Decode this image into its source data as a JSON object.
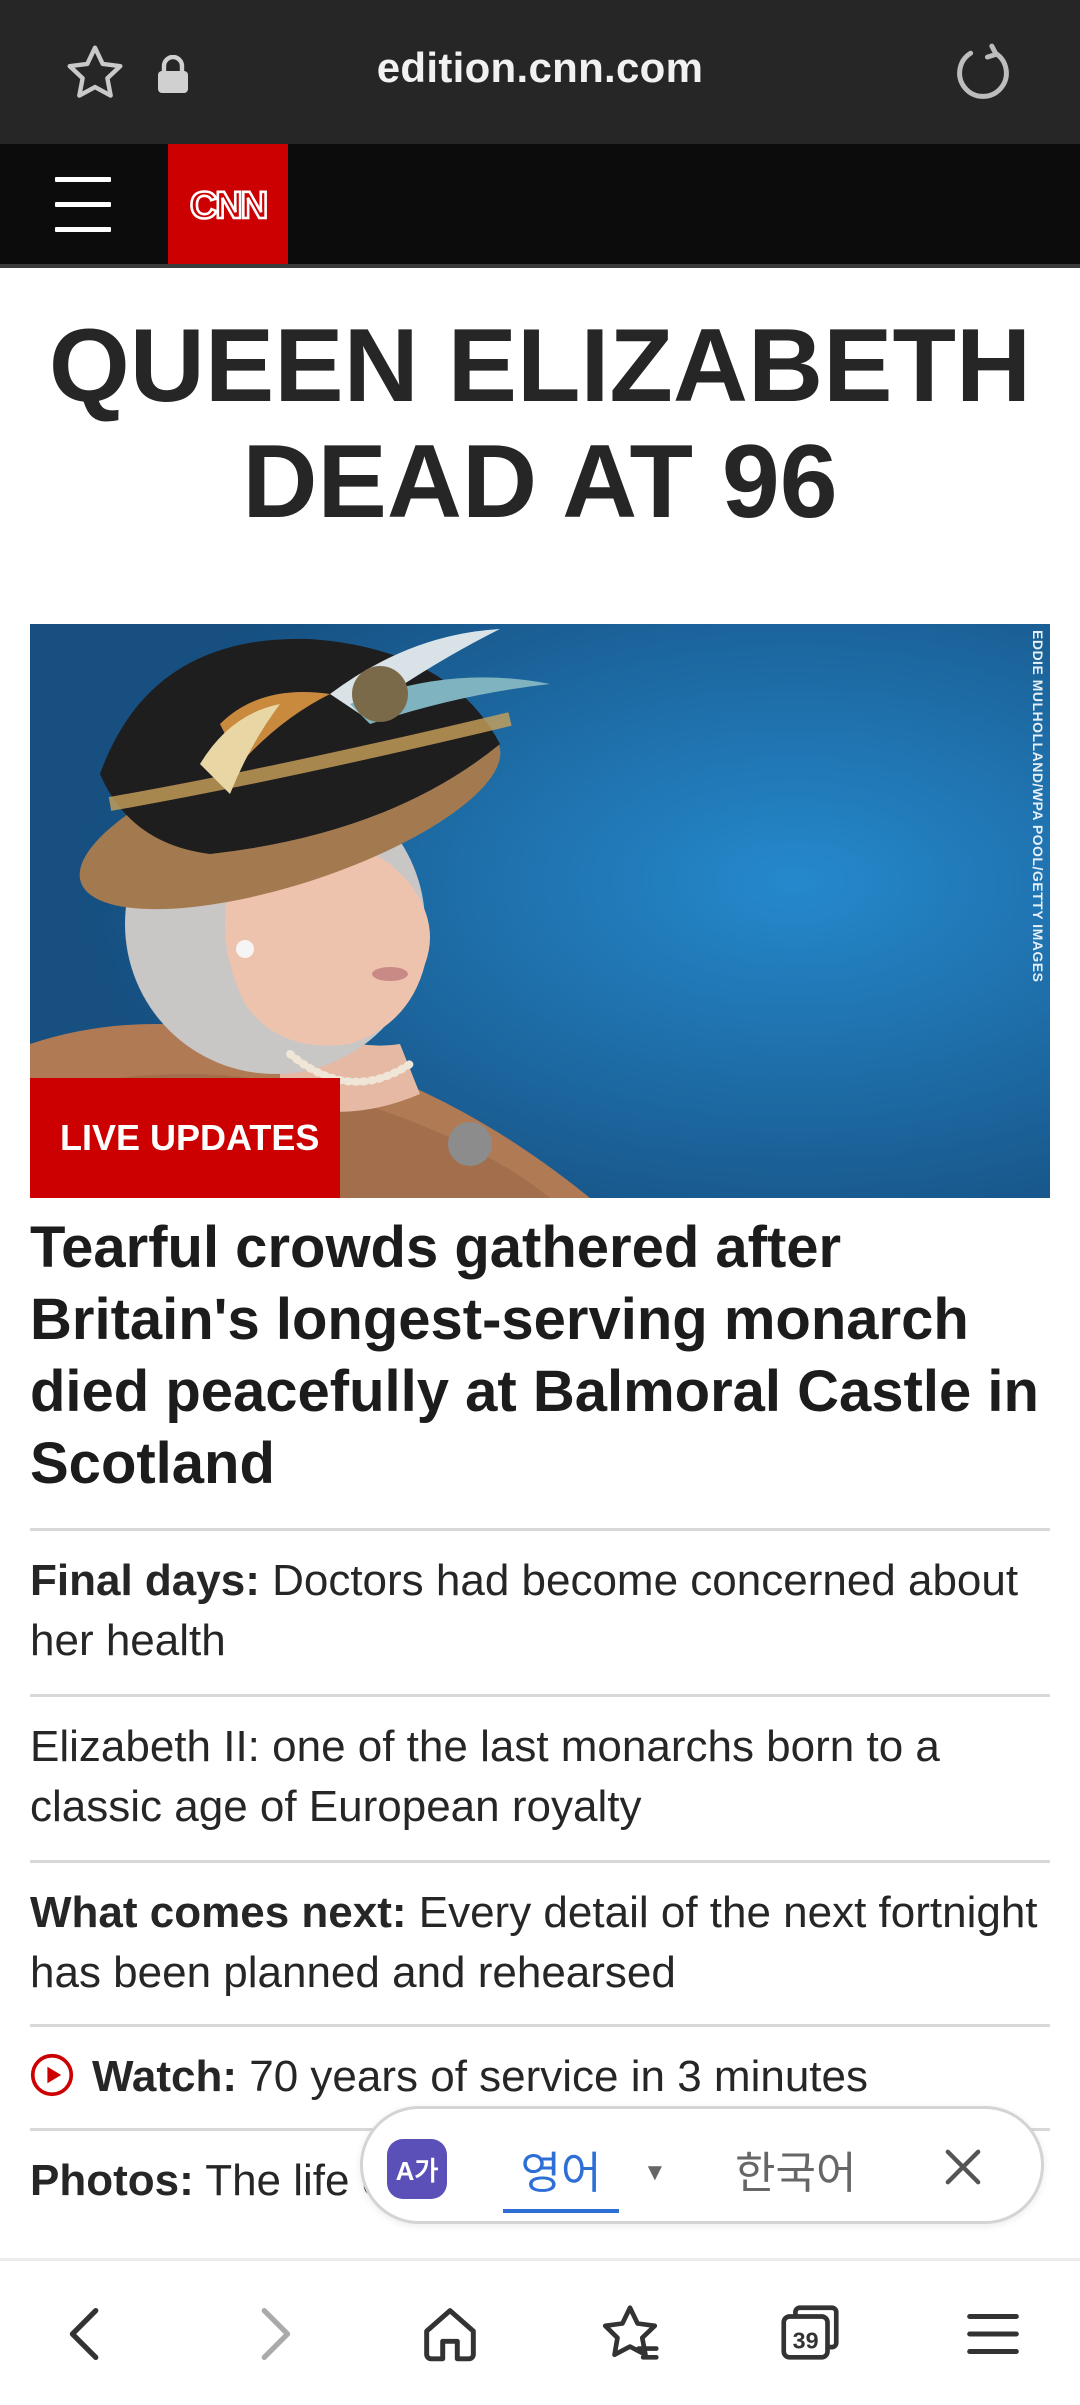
{
  "browser": {
    "url": "edition.cnn.com"
  },
  "site": {
    "logo_text": "CNN"
  },
  "headline": {
    "line1": "QUEEN ELIZABETH",
    "line2": "DEAD AT 96"
  },
  "hero": {
    "photo_credit": "EDDIE MULHOLLAND/WPA POOL/GETTY IMAGES",
    "badge": "LIVE UPDATES"
  },
  "lead_story": "Tearful crowds gathered after Britain's longest-serving monarch died peacefully at Balmoral Castle in Scotland",
  "stories": [
    {
      "label": "Final days:",
      "text": " Doctors had become concerned about her health"
    },
    {
      "label": "",
      "text": "Elizabeth II: one of the last monarchs born to a classic age of European royalty"
    },
    {
      "label": "What comes next:",
      "text": " Every detail of the next fortnight has been planned and rehearsed"
    },
    {
      "label": "Watch:",
      "text": " 70 years of service in 3 minutes",
      "icon": "play-icon"
    },
    {
      "label": "Photos:",
      "text": " The life of Queen Elizabeth II in pictures"
    }
  ],
  "translate_bar": {
    "source_lang": "영어",
    "target_lang": "한국어",
    "icon_text": "A가"
  },
  "bottom_nav": {
    "tab_count": "39"
  },
  "colors": {
    "cnn_red": "#cc0000",
    "browser_bar": "#262626",
    "translate_accent": "#2e6fd6"
  }
}
